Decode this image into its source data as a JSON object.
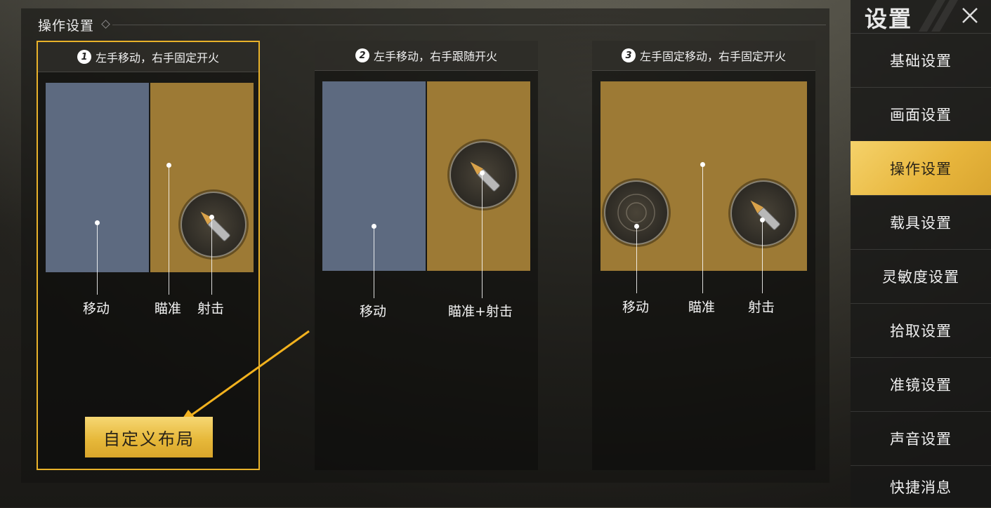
{
  "section": {
    "title": "操作设置"
  },
  "cards": [
    {
      "number": "1",
      "title": "左手移动，右手固定开火",
      "labels": {
        "move": "移动",
        "aim": "瞄准",
        "fire": "射击"
      }
    },
    {
      "number": "2",
      "title": "左手移动，右手跟随开火",
      "labels": {
        "move": "移动",
        "aimfire": "瞄准+射击"
      }
    },
    {
      "number": "3",
      "title": "左手固定移动，右手固定开火",
      "labels": {
        "move": "移动",
        "aim": "瞄准",
        "fire": "射击"
      }
    }
  ],
  "custom_layout_button": "自定义布局",
  "sidebar": {
    "title": "设置",
    "items": [
      "基础设置",
      "画面设置",
      "操作设置",
      "载具设置",
      "灵敏度设置",
      "拾取设置",
      "准镜设置",
      "声音设置",
      "快捷消息"
    ],
    "active_index": 2
  },
  "colors": {
    "accent": "#e9b22a",
    "move_zone": "#5d6a80",
    "aim_zone": "#9d7a35"
  },
  "icons": [
    "bullet-icon",
    "joystick-icon",
    "close-icon"
  ]
}
